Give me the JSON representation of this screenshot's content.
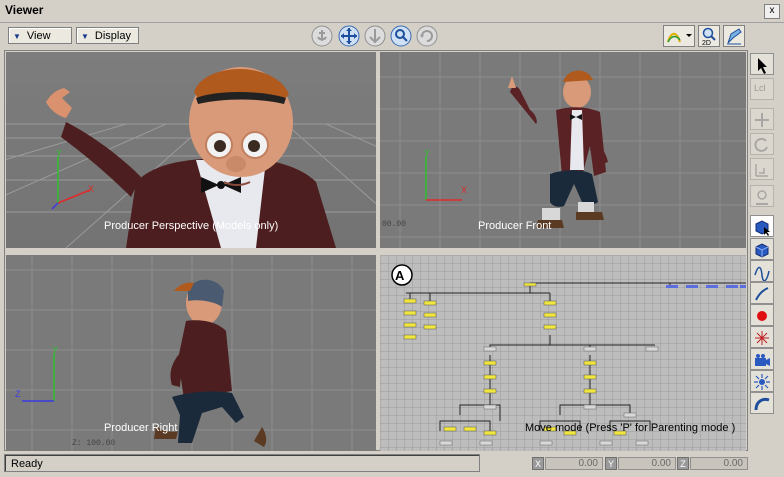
{
  "window": {
    "title": "Viewer",
    "close_glyph": "x"
  },
  "toolbar": {
    "view_label": "View",
    "display_label": "Display",
    "nav_tools": [
      "pan-anchor-icon",
      "move-cross-icon",
      "dolly-icon",
      "zoom-magnifier-icon",
      "rotate-orbit-icon"
    ],
    "right_tools": [
      "curve-mode-icon",
      "zoom-2d-icon",
      "pen-edit-icon"
    ],
    "zoom_2d_label": "2D"
  },
  "viewports": {
    "perspective": {
      "label": "Producer Perspective (Models only)"
    },
    "front": {
      "label": "Producer Front",
      "coord": "00.00"
    },
    "right": {
      "label": "Producer Right",
      "coord": "Z: 100.00"
    },
    "schematic": {
      "badge": "A",
      "hint": "Move mode (Press 'P' for Parenting mode )"
    }
  },
  "side_tools": [
    {
      "name": "select-arrow-icon",
      "enabled": true
    },
    {
      "name": "local-lcl-icon",
      "label": "Lcl",
      "enabled": false
    },
    {
      "name": "translate-icon",
      "enabled": false
    },
    {
      "name": "rotate-icon",
      "enabled": false
    },
    {
      "name": "scale-icon",
      "enabled": false
    },
    {
      "name": "weight-icon",
      "enabled": false
    },
    {
      "name": "select-model-icon",
      "enabled": true
    },
    {
      "name": "cube-icon",
      "enabled": true
    },
    {
      "name": "curve-icon",
      "enabled": true
    },
    {
      "name": "bone-icon",
      "enabled": true
    },
    {
      "name": "red-dot-icon",
      "enabled": true
    },
    {
      "name": "null-marker-icon",
      "enabled": true
    },
    {
      "name": "camera-icon",
      "enabled": true
    },
    {
      "name": "light-icon",
      "enabled": true
    },
    {
      "name": "path-icon",
      "enabled": true
    }
  ],
  "status": {
    "text": "Ready",
    "x_label": "X",
    "x_value": "0.00",
    "y_label": "Y",
    "y_value": "0.00",
    "z_label": "Z",
    "z_value": "0.00"
  },
  "colors": {
    "accent": "#1a3a8a",
    "viewport_bg": "#7a7a7a",
    "schematic_bg": "#bdbdbd",
    "node_yellow": "#f0e63c",
    "node_blue": "#5a6ee0"
  }
}
